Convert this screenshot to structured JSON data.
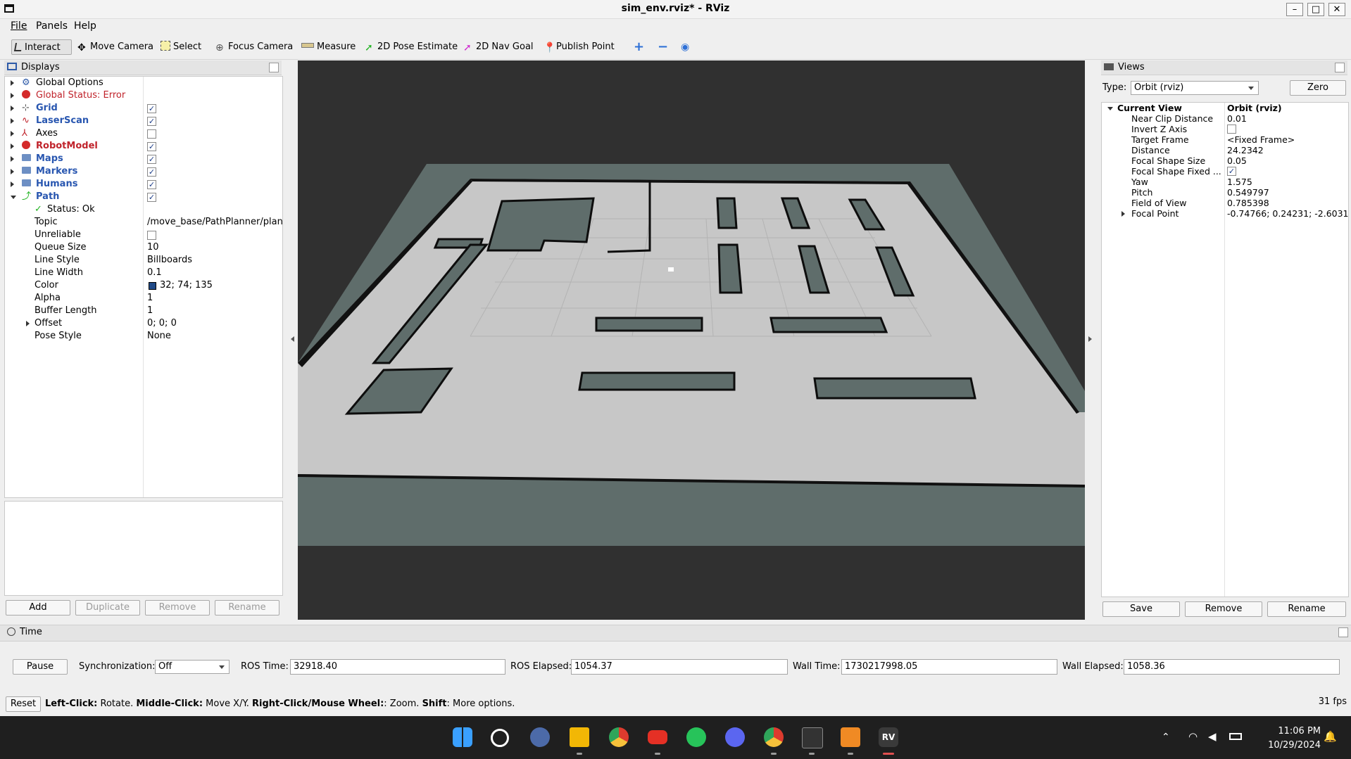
{
  "window": {
    "title": "sim_env.rviz* - RViz",
    "min": "–",
    "max": "□",
    "close": "✕"
  },
  "menu": [
    "File",
    "Panels",
    "Help"
  ],
  "toolbar": {
    "tools": [
      {
        "label": "Interact",
        "icon": "pointer-icon",
        "active": true
      },
      {
        "label": "Move Camera",
        "icon": "move-icon"
      },
      {
        "label": "Select",
        "icon": "select-icon"
      },
      {
        "label": "Focus Camera",
        "icon": "focus-icon"
      },
      {
        "label": "Measure",
        "icon": "ruler-icon"
      },
      {
        "label": "2D Pose Estimate",
        "icon": "green-arrow-icon"
      },
      {
        "label": "2D Nav Goal",
        "icon": "pink-arrow-icon"
      },
      {
        "label": "Publish Point",
        "icon": "map-pin-icon"
      }
    ]
  },
  "displays": {
    "title": "Displays",
    "items": [
      {
        "label": "Global Options",
        "style": "normal",
        "icon": "gear-icon"
      },
      {
        "label": "Global Status: Error",
        "style": "error",
        "icon": "error-icon"
      },
      {
        "label": "Grid",
        "style": "blue",
        "icon": "grid-icon",
        "checked": true
      },
      {
        "label": "LaserScan",
        "style": "blue",
        "icon": "laser-icon",
        "checked": true
      },
      {
        "label": "Axes",
        "style": "normal",
        "icon": "axes-icon",
        "checked": false
      },
      {
        "label": "RobotModel",
        "style": "red",
        "icon": "error-icon",
        "checked": true
      },
      {
        "label": "Maps",
        "style": "blue",
        "icon": "folder-icon",
        "checked": true
      },
      {
        "label": "Markers",
        "style": "blue",
        "icon": "folder-icon",
        "checked": true
      },
      {
        "label": "Humans",
        "style": "blue",
        "icon": "folder-icon",
        "checked": true
      },
      {
        "label": "Path",
        "style": "blue",
        "icon": "path-icon",
        "checked": true
      }
    ],
    "path_props": [
      {
        "name": "Status: Ok",
        "value": ""
      },
      {
        "name": "Topic",
        "value": "/move_base/PathPlanner/plan"
      },
      {
        "name": "Unreliable",
        "value": ""
      },
      {
        "name": "Queue Size",
        "value": "10"
      },
      {
        "name": "Line Style",
        "value": "Billboards"
      },
      {
        "name": "Line Width",
        "value": "0.1"
      },
      {
        "name": "Color",
        "value": "32; 74; 135"
      },
      {
        "name": "Alpha",
        "value": "1"
      },
      {
        "name": "Buffer Length",
        "value": "1"
      },
      {
        "name": "Offset",
        "value": "0; 0; 0"
      },
      {
        "name": "Pose Style",
        "value": "None"
      }
    ],
    "path_color": "#204a87",
    "buttons": [
      "Add",
      "Duplicate",
      "Remove",
      "Rename"
    ]
  },
  "views": {
    "title": "Views",
    "type_label": "Type:",
    "type_value": "Orbit (rviz)",
    "zero": "Zero",
    "current_view": {
      "label": "Current View",
      "value": "Orbit (rviz)"
    },
    "props": [
      {
        "name": "Near Clip Distance",
        "value": "0.01"
      },
      {
        "name": "Invert Z Axis",
        "value": ""
      },
      {
        "name": "Target Frame",
        "value": "<Fixed Frame>"
      },
      {
        "name": "Distance",
        "value": "24.2342"
      },
      {
        "name": "Focal Shape Size",
        "value": "0.05"
      },
      {
        "name": "Focal Shape Fixed ...",
        "value": ""
      },
      {
        "name": "Yaw",
        "value": "1.575"
      },
      {
        "name": "Pitch",
        "value": "0.549797"
      },
      {
        "name": "Field of View",
        "value": "0.785398"
      },
      {
        "name": "Focal Point",
        "value": "-0.74766; 0.24231; -2.6031"
      }
    ],
    "buttons": [
      "Save",
      "Remove",
      "Rename"
    ]
  },
  "time": {
    "title": "Time",
    "pause": "Pause",
    "sync_label": "Synchronization:",
    "sync_value": "Off",
    "ros_time_label": "ROS Time:",
    "ros_time": "32918.40",
    "ros_elapsed_label": "ROS Elapsed:",
    "ros_elapsed": "1054.37",
    "wall_time_label": "Wall Time:",
    "wall_time": "1730217998.05",
    "wall_elapsed_label": "Wall Elapsed:",
    "wall_elapsed": "1058.36"
  },
  "status": {
    "reset": "Reset",
    "parts": [
      {
        "b": "Left-Click:",
        "t": " Rotate. "
      },
      {
        "b": "Middle-Click:",
        "t": " Move X/Y. "
      },
      {
        "b": "Right-Click/Mouse Wheel:",
        "t": ": Zoom. "
      },
      {
        "b": "Shift",
        "t": ": More options."
      }
    ],
    "fps": "31 fps"
  },
  "taskbar": {
    "time": "11:06 PM",
    "date": "10/29/2024",
    "apps": [
      "windows-start-icon",
      "search-icon",
      "settings-icon",
      "file-explorer-icon",
      "chrome-icon",
      "youtube-icon",
      "whatsapp-icon",
      "discord-icon",
      "chrome-icon",
      "terminal-icon",
      "ros-app-icon",
      "rviz-icon"
    ]
  }
}
